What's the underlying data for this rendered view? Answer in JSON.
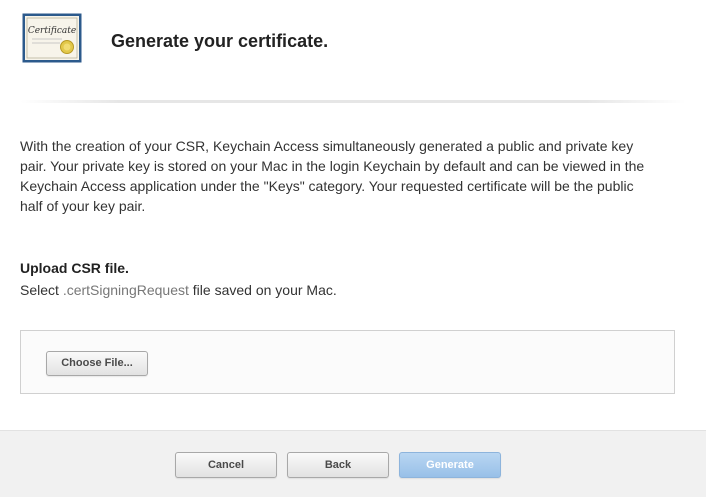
{
  "header": {
    "title": "Generate your certificate.",
    "icon": "certificate-icon",
    "icon_text": "Certificate"
  },
  "intro": {
    "text": "With the creation of your CSR, Keychain Access simultaneously generated a public and private key pair. Your private key is stored on your Mac in the login Keychain by default and can be viewed in the Keychain Access application under the \"Keys\" category. Your requested certificate will be the public half of your key pair."
  },
  "upload": {
    "title": "Upload CSR file.",
    "subtitle_prefix": "Select ",
    "subtitle_ext": ".certSigningRequest",
    "subtitle_suffix": " file saved on your Mac.",
    "choose_label": "Choose File..."
  },
  "footer": {
    "cancel_label": "Cancel",
    "back_label": "Back",
    "generate_label": "Generate"
  },
  "colors": {
    "primary_disabled": "#a7c9ee",
    "footer_bg": "#f1f1f1"
  }
}
